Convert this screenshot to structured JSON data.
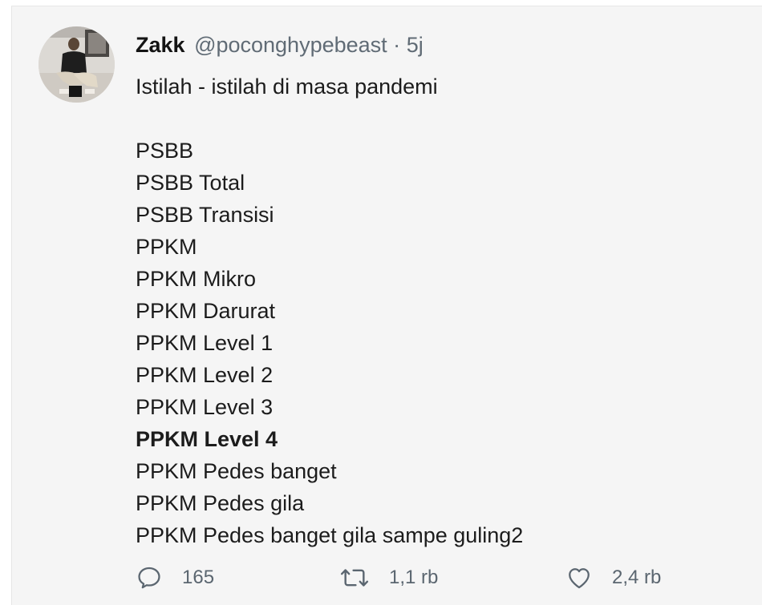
{
  "tweet": {
    "display_name": "Zakk",
    "handle": "@poconghypebeast",
    "separator": "·",
    "time": "5j",
    "text_lines": [
      {
        "text": "Istilah - istilah di masa pandemi",
        "bold": false
      },
      {
        "text": "",
        "bold": false
      },
      {
        "text": "PSBB",
        "bold": false
      },
      {
        "text": "PSBB Total",
        "bold": false
      },
      {
        "text": "PSBB Transisi",
        "bold": false
      },
      {
        "text": "PPKM",
        "bold": false
      },
      {
        "text": "PPKM Mikro",
        "bold": false
      },
      {
        "text": "PPKM Darurat",
        "bold": false
      },
      {
        "text": "PPKM Level 1",
        "bold": false
      },
      {
        "text": "PPKM Level 2",
        "bold": false
      },
      {
        "text": "PPKM Level 3",
        "bold": false
      },
      {
        "text": "PPKM Level 4",
        "bold": true
      },
      {
        "text": "PPKM Pedes banget",
        "bold": false
      },
      {
        "text": "PPKM Pedes gila",
        "bold": false
      },
      {
        "text": "PPKM Pedes banget gila sampe guling2",
        "bold": false
      }
    ],
    "actions": {
      "reply": {
        "icon": "reply-icon",
        "count": "165"
      },
      "retweet": {
        "icon": "retweet-icon",
        "count": "1,1 rb"
      },
      "like": {
        "icon": "heart-icon",
        "count": "2,4 rb"
      }
    }
  },
  "colors": {
    "background": "#f5f5f5",
    "text": "#1c1c1c",
    "secondary_text": "#606b75"
  }
}
